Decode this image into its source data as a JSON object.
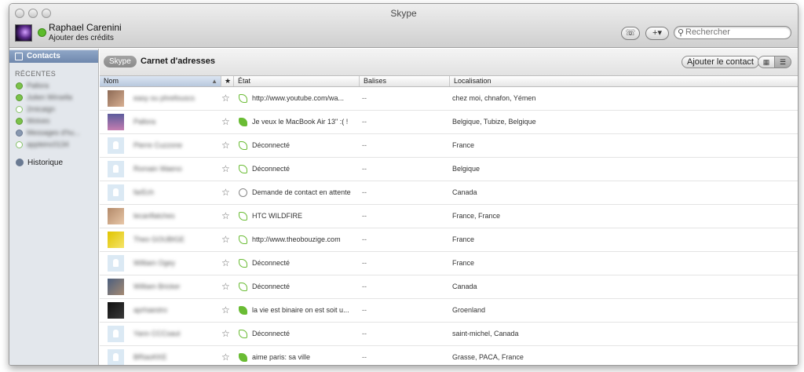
{
  "window": {
    "title": "Skype"
  },
  "user": {
    "name": "Raphael Carenini",
    "credit_link": "Ajouter des crédits"
  },
  "toolbar": {
    "dialpad_label": "☏",
    "add_label": "+▾"
  },
  "search": {
    "placeholder": "Rechercher",
    "icon": "search-icon"
  },
  "sidebar": {
    "selected": "Contacts",
    "recent_header": "RÉCENTES",
    "recent_items": [
      {
        "label": "Pallora",
        "status": "online"
      },
      {
        "label": "Julien Wirsella",
        "status": "online"
      },
      {
        "label": "2micaign",
        "status": "offline"
      },
      {
        "label": "Wolves",
        "status": "online"
      },
      {
        "label": "Messages d'hu...",
        "status": "group"
      },
      {
        "label": "appleinc0134",
        "status": "offline"
      }
    ],
    "history": "Historique"
  },
  "main": {
    "source_badge": "Skype",
    "title": "Carnet d'adresses",
    "add_contact": "Ajouter le contact",
    "view_grid_icon": "grid-view-icon",
    "view_list_icon": "list-view-icon"
  },
  "table": {
    "columns": [
      "Nom",
      "★",
      "État",
      "Balises",
      "Localisation"
    ],
    "rows": [
      {
        "name": "easy ou phrefouscs",
        "status": "http://www.youtube.com/wa...",
        "tags": "--",
        "location": "chez moi, chnafon, Yémen",
        "state": "offline",
        "pic": "photo1"
      },
      {
        "name": "Pallora",
        "status": "Je veux le MacBook Air 13\" :( !",
        "tags": "--",
        "location": "Belgique, Tubize, Belgique",
        "state": "online",
        "pic": "photo2"
      },
      {
        "name": "Pierre Cuzzone",
        "status": "Déconnecté",
        "tags": "--",
        "location": "France",
        "state": "offline",
        "pic": "default"
      },
      {
        "name": "Romain Waeno",
        "status": "Déconnecté",
        "tags": "--",
        "location": "Belgique",
        "state": "offline",
        "pic": "default"
      },
      {
        "name": "farEch",
        "status": "Demande de contact en attente",
        "tags": "--",
        "location": "Canada",
        "state": "pending",
        "pic": "default"
      },
      {
        "name": "lecanflatches",
        "status": "HTC WILDFIRE",
        "tags": "--",
        "location": "France, France",
        "state": "offline",
        "pic": "photo3"
      },
      {
        "name": "Theo GOUBIGE",
        "status": "http://www.theobouzige.com",
        "tags": "--",
        "location": "France",
        "state": "offline",
        "pic": "photo4"
      },
      {
        "name": "William Ogey",
        "status": "Déconnecté",
        "tags": "--",
        "location": "France",
        "state": "offline",
        "pic": "default"
      },
      {
        "name": "William Bricker",
        "status": "Déconnecté",
        "tags": "--",
        "location": "Canada",
        "state": "offline",
        "pic": "photo5"
      },
      {
        "name": "aprhaestro",
        "status": "la vie est binaire on est soit u...",
        "tags": "--",
        "location": "Groenland",
        "state": "online",
        "pic": "photo6"
      },
      {
        "name": "Yann CCCsaut",
        "status": "Déconnecté",
        "tags": "--",
        "location": "saint-michel, Canada",
        "state": "offline",
        "pic": "default"
      },
      {
        "name": "BRiaoKKE",
        "status": "aime paris: sa ville",
        "tags": "--",
        "location": "Grasse, PACA, France",
        "state": "online",
        "pic": "default"
      }
    ]
  },
  "colors": {
    "accent": "#6f88ad",
    "online": "#6abc34",
    "sidebar_bg": "#e3e7ec"
  }
}
